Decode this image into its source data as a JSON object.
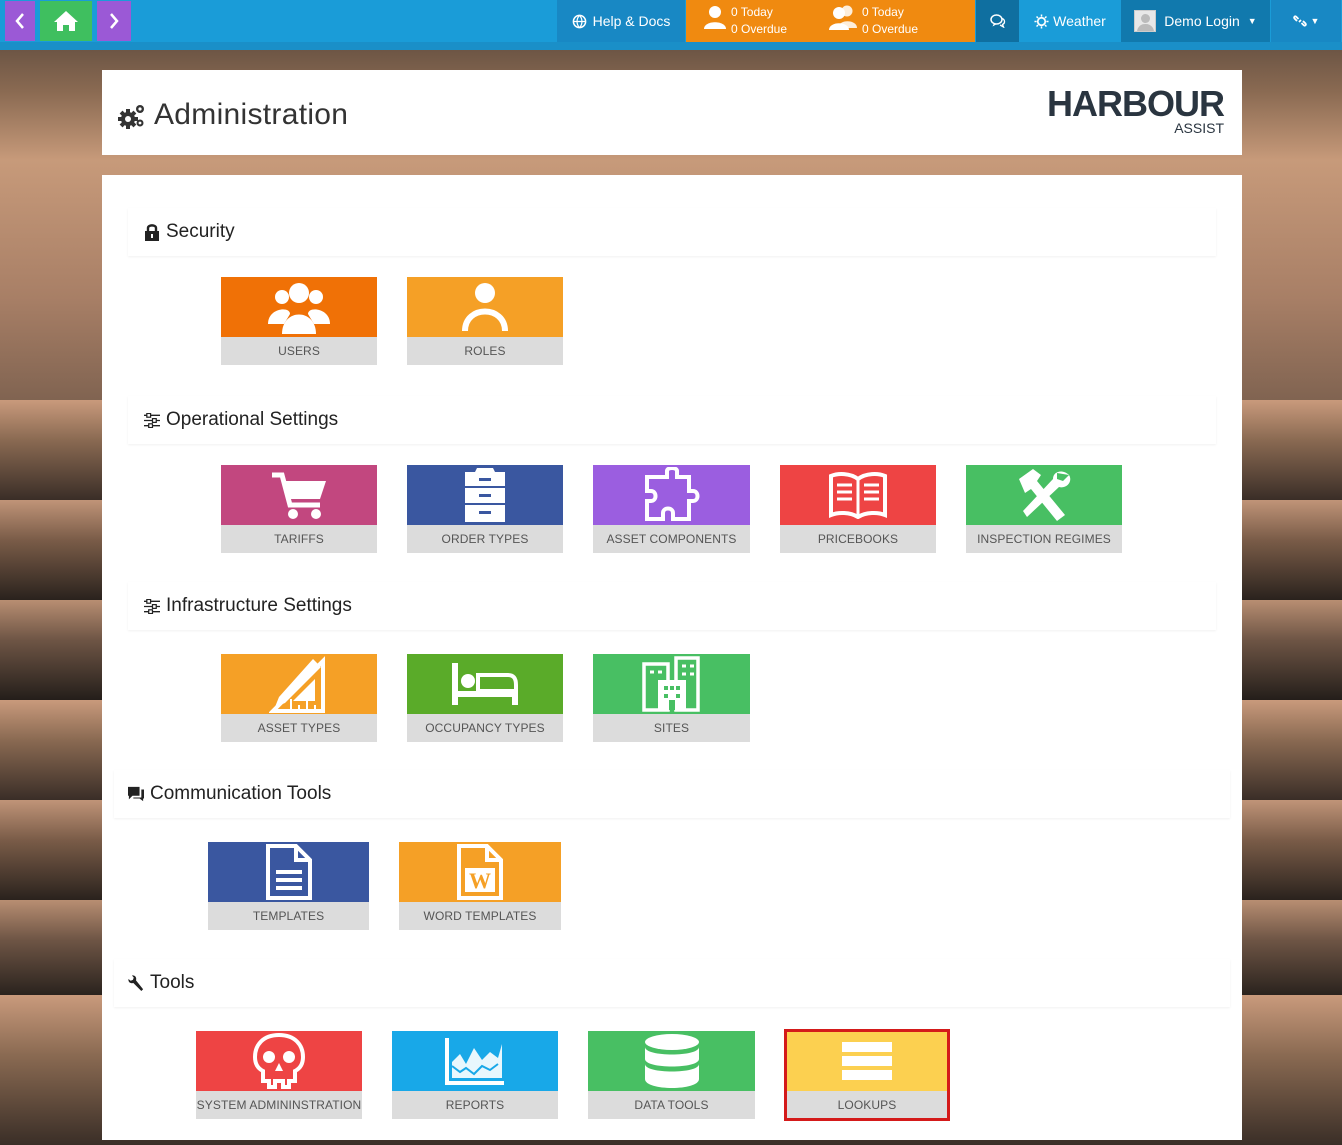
{
  "nav": {
    "back_icon": "chevron-left-icon",
    "home_icon": "home-icon",
    "forward_icon": "chevron-right-icon",
    "help_label": "Help & Docs",
    "tasks_mine": {
      "today": "0 Today",
      "overdue": "0 Overdue"
    },
    "tasks_team": {
      "today": "0 Today",
      "overdue": "0 Overdue"
    },
    "weather_label": "Weather",
    "user_label": "Demo Login",
    "colors": {
      "bar": "#1a9cd8",
      "back": "#9b59d6",
      "home": "#3fbf5f",
      "tasks": "#f08a10"
    }
  },
  "header": {
    "title": "Administration",
    "logo_main": "HARBOUR",
    "logo_sub": "ASSIST"
  },
  "sections": {
    "security": {
      "title": "Security",
      "tiles": [
        {
          "label": "USERS",
          "color": "#f07106"
        },
        {
          "label": "ROLES",
          "color": "#f5a026"
        }
      ]
    },
    "operational": {
      "title": "Operational Settings",
      "tiles": [
        {
          "label": "TARIFFS",
          "color": "#c2477f"
        },
        {
          "label": "ORDER TYPES",
          "color": "#3a57a0"
        },
        {
          "label": "ASSET COMPONENTS",
          "color": "#9b5ee0"
        },
        {
          "label": "PRICEBOOKS",
          "color": "#ee4444"
        },
        {
          "label": "INSPECTION REGIMES",
          "color": "#48bf63"
        }
      ]
    },
    "infrastructure": {
      "title": "Infrastructure Settings",
      "tiles": [
        {
          "label": "ASSET TYPES",
          "color": "#f5a026"
        },
        {
          "label": "OCCUPANCY TYPES",
          "color": "#5aab29"
        },
        {
          "label": "SITES",
          "color": "#48bf63"
        }
      ]
    },
    "communication": {
      "title": "Communication Tools",
      "tiles": [
        {
          "label": "TEMPLATES",
          "color": "#3a57a0"
        },
        {
          "label": "WORD TEMPLATES",
          "color": "#f5a026"
        }
      ]
    },
    "tools": {
      "title": "Tools",
      "tiles": [
        {
          "label": "SYSTEM ADMININSTRATION",
          "color": "#ee4444"
        },
        {
          "label": "REPORTS",
          "color": "#18a8e8"
        },
        {
          "label": "DATA TOOLS",
          "color": "#48bf63"
        },
        {
          "label": "LOOKUPS",
          "color": "#fcd050"
        }
      ]
    }
  }
}
